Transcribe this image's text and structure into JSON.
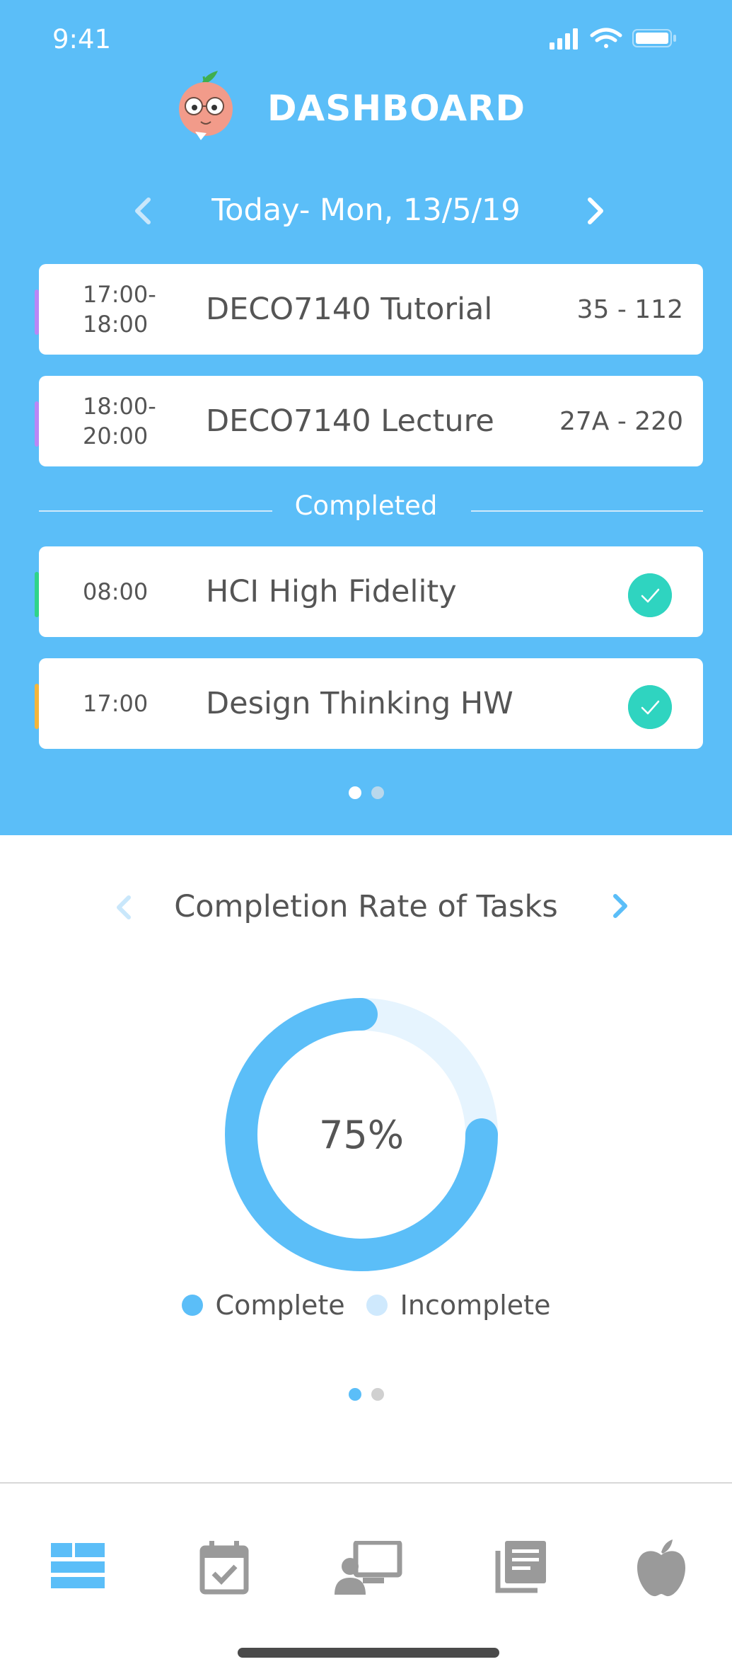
{
  "status_bar": {
    "time": "9:41"
  },
  "header": {
    "title": "DASHBOARD",
    "logo_icon": "peach-mascot-icon"
  },
  "date_nav": {
    "label": "Today- Mon, 13/5/19"
  },
  "schedule": [
    {
      "time": "17:00-\n18:00",
      "title": "DECO7140 Tutorial",
      "room": "35 - 112",
      "accent": "#b987f5"
    },
    {
      "time": "18:00-\n20:00",
      "title": "DECO7140 Lecture",
      "room": "27A - 220",
      "accent": "#b987f5"
    }
  ],
  "completed_section": {
    "label": "Completed"
  },
  "completed": [
    {
      "time": "08:00",
      "title": "HCI High Fidelity",
      "accent": "#2fd48a"
    },
    {
      "time": "17:00",
      "title": "Design Thinking HW",
      "accent": "#f5b53a"
    }
  ],
  "top_pager": {
    "count": 2,
    "active": 0
  },
  "chart_section": {
    "title": "Completion Rate of Tasks"
  },
  "chart_data": {
    "type": "pie",
    "title": "Completion Rate of Tasks",
    "center_label": "75%",
    "categories": [
      "Complete",
      "Incomplete"
    ],
    "values": [
      75,
      25
    ],
    "colors": [
      "#5bbef8",
      "#e6f4fe"
    ]
  },
  "legend": {
    "complete": "Complete",
    "incomplete": "Incomplete",
    "complete_color": "#5bbef8",
    "incomplete_color": "#cfe9fd"
  },
  "bottom_pager": {
    "count": 2,
    "active": 0
  },
  "tab_bar": {
    "items": [
      {
        "icon": "dashboard-icon",
        "active": true
      },
      {
        "icon": "calendar-check-icon",
        "active": false
      },
      {
        "icon": "presentation-icon",
        "active": false
      },
      {
        "icon": "notes-icon",
        "active": false
      },
      {
        "icon": "apple-icon",
        "active": false
      }
    ]
  },
  "colors": {
    "primary": "#5bbef8",
    "text": "#555555",
    "icon_gray": "#9a9a9a",
    "check": "#2fd4c0"
  }
}
